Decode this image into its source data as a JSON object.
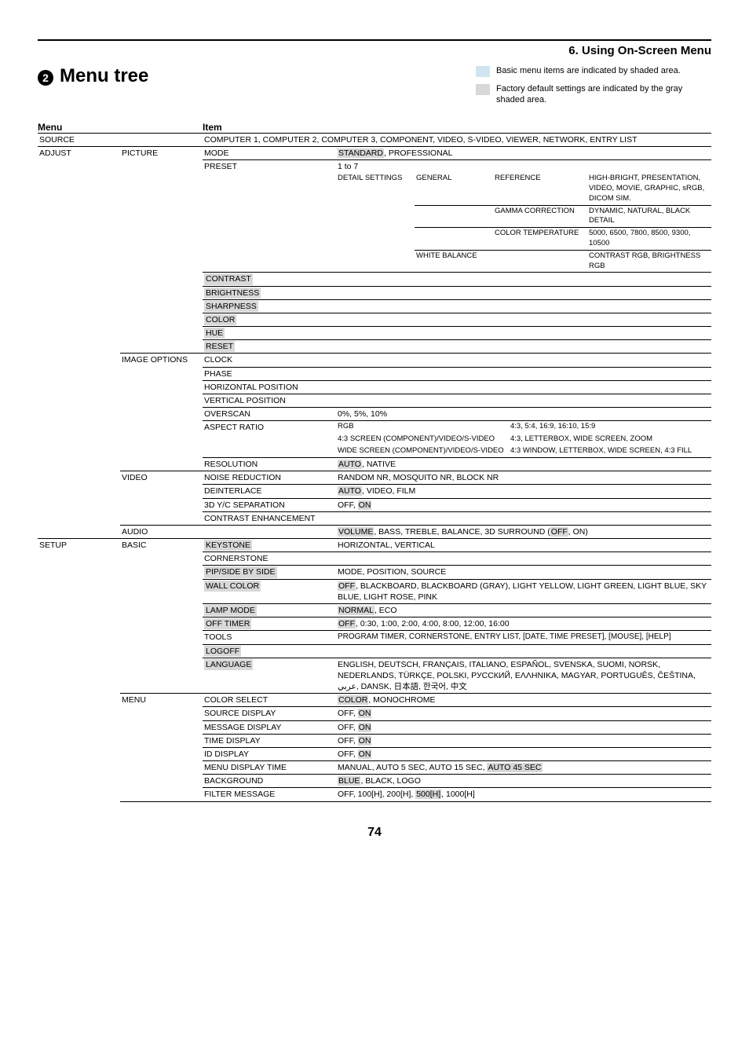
{
  "section_header": "6. Using On-Screen Menu",
  "circled_num": "2",
  "main_title": "Menu tree",
  "legend1": "Basic menu items are indicated by shaded area.",
  "legend2": "Factory default settings are indicated by the gray shaded area.",
  "headers": {
    "menu": "Menu",
    "item": "Item"
  },
  "menu_source": "SOURCE",
  "source_items": "COMPUTER 1, COMPUTER 2, COMPUTER 3, COMPONENT, VIDEO, S-VIDEO, VIEWER, NETWORK, ENTRY LIST",
  "menu_adjust": "ADJUST",
  "picture": "PICTURE",
  "mode": "MODE",
  "mode_val_default": "STANDARD",
  "mode_val_rest": ", PROFESSIONAL",
  "preset": "PRESET",
  "preset_val": "1 to 7",
  "detail_settings": "DETAIL SETTINGS",
  "general": "GENERAL",
  "reference": "REFERENCE",
  "reference_val": "HIGH-BRIGHT, PRESENTATION, VIDEO, MOVIE, GRAPHIC, sRGB, DICOM SIM.",
  "gamma": "GAMMA CORRECTION",
  "gamma_val": "DYNAMIC, NATURAL, BLACK DETAIL",
  "color_temp": "COLOR TEMPERATURE",
  "color_temp_val": "5000, 6500, 7800, 8500, 9300, 10500",
  "white_balance": "WHITE BALANCE",
  "white_balance_val": "CONTRAST RGB, BRIGHTNESS RGB",
  "contrast": "CONTRAST",
  "brightness": "BRIGHTNESS",
  "sharpness": "SHARPNESS",
  "color": "COLOR",
  "hue": "HUE",
  "reset": "RESET",
  "image_options": "IMAGE OPTIONS",
  "clock": "CLOCK",
  "phase": "PHASE",
  "hpos": "HORIZONTAL POSITION",
  "vpos": "VERTICAL POSITION",
  "overscan": "OVERSCAN",
  "overscan_val": "0%, 5%, 10%",
  "aspect": "ASPECT RATIO",
  "aspect_rgb": "RGB",
  "aspect_rgb_val": "4:3, 5:4, 16:9, 16:10, 15:9",
  "aspect_43s": "4:3 SCREEN (COMPONENT)/VIDEO/S-VIDEO",
  "aspect_43s_val": "4:3, LETTERBOX, WIDE SCREEN, ZOOM",
  "aspect_ws": "WIDE SCREEN (COMPONENT)/VIDEO/S-VIDEO",
  "aspect_ws_val": "4:3 WINDOW, LETTERBOX, WIDE SCREEN, 4:3 FILL",
  "resolution": "RESOLUTION",
  "resolution_val_default": "AUTO",
  "resolution_val_rest": ", NATIVE",
  "video": "VIDEO",
  "noise_reduction": "NOISE REDUCTION",
  "noise_reduction_val": "RANDOM NR, MOSQUITO NR, BLOCK NR",
  "deinterlace": "DEINTERLACE",
  "deinterlace_val_default": "AUTO",
  "deinterlace_val_rest": ", VIDEO, FILM",
  "yc": "3D Y/C SEPARATION",
  "yc_val_pre": "OFF, ",
  "yc_val_default": "ON",
  "contrast_enh": "CONTRAST ENHANCEMENT",
  "audio": "AUDIO",
  "audio_val_pre": "VOLUME",
  "audio_val_mid": ", BASS, TREBLE, BALANCE, 3D SURROUND (",
  "audio_val_off": "OFF",
  "audio_val_post": ", ON)",
  "menu_setup": "SETUP",
  "basic": "BASIC",
  "keystone": "KEYSTONE",
  "keystone_val": "HORIZONTAL, VERTICAL",
  "cornerstone": "CORNERSTONE",
  "pip": "PIP/SIDE BY SIDE",
  "pip_val": "MODE, POSITION, SOURCE",
  "wall_color": "WALL COLOR",
  "wall_color_val_default": "OFF",
  "wall_color_val_rest": ", BLACKBOARD, BLACKBOARD (GRAY), LIGHT YELLOW, LIGHT GREEN, LIGHT BLUE, SKY BLUE, LIGHT ROSE, PINK",
  "lamp_mode": "LAMP MODE",
  "lamp_mode_val_default": "NORMAL",
  "lamp_mode_val_rest": ", ECO",
  "off_timer": "OFF TIMER",
  "off_timer_val_default": "OFF",
  "off_timer_val_rest": ", 0:30, 1:00, 2:00, 4:00, 8:00, 12:00, 16:00",
  "tools": "TOOLS",
  "tools_val": "PROGRAM TIMER, CORNERSTONE, ENTRY LIST, [DATE, TIME PRESET], [MOUSE], [HELP]",
  "logoff": "LOGOFF",
  "language": "LANGUAGE",
  "language_val": "ENGLISH, DEUTSCH, FRANÇAIS, ITALIANO, ESPAÑOL, SVENSKA, SUOMI, NORSK, NEDERLANDS, TÜRKÇE, POLSKI, РУССКИЙ, ΕΛΛΗΝΙΚΑ, MAGYAR, PORTUGUÊS, ČEŠTINA, عربي, DANSK, 日本語, 한국어, 中文",
  "menu_sub": "MENU",
  "color_select": "COLOR SELECT",
  "color_select_val_default": "COLOR",
  "color_select_val_rest": ", MONOCHROME",
  "source_display": "SOURCE DISPLAY",
  "offon_pre": "OFF, ",
  "offon_on": "ON",
  "message_display": "MESSAGE DISPLAY",
  "time_display": "TIME DISPLAY",
  "id_display": "ID DISPLAY",
  "menu_display_time": "MENU DISPLAY TIME",
  "mdt_val_pre": "MANUAL, AUTO 5 SEC, AUTO 15 SEC, ",
  "mdt_val_default": "AUTO 45 SEC",
  "background": "BACKGROUND",
  "background_val_default": "BLUE",
  "background_val_rest": ", BLACK, LOGO",
  "filter_message": "FILTER MESSAGE",
  "filter_val_pre": "OFF, 100[H], 200[H], ",
  "filter_val_default": "500[H]",
  "filter_val_post": ", 1000[H]",
  "page_num": "74"
}
